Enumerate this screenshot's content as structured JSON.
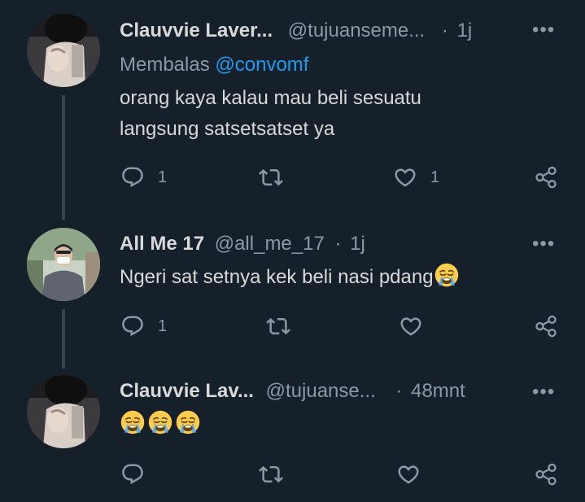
{
  "tweets": [
    {
      "name": "Clauvvie Laver...",
      "handle": "@tujuanseme...",
      "dot": "·",
      "time": "1j",
      "more": "•••",
      "reply_prefix": "Membalas",
      "reply_mention": "@convomf",
      "lines": [
        "orang kaya kalau mau beli sesuatu",
        "langsung satsetsatset ya"
      ],
      "reply_count": "1",
      "retweet_count": "",
      "like_count": "1"
    },
    {
      "name": "All Me 17",
      "handle": "@all_me_17",
      "dot": "·",
      "time": "1j",
      "more": "•••",
      "text": "Ngeri sat setnya kek beli nasi pdang",
      "reply_count": "1",
      "retweet_count": "",
      "like_count": ""
    },
    {
      "name": "Clauvvie Lav...",
      "handle": "@tujuanse...",
      "dot": "·",
      "time": "48mnt",
      "more": "•••",
      "emoji_count": 3,
      "reply_count": "",
      "retweet_count": "",
      "like_count": ""
    }
  ],
  "icons": {
    "reply": "reply-icon",
    "retweet": "retweet-icon",
    "like": "heart-icon",
    "share": "share-icon",
    "emoji": "loudly-crying-face-emoji"
  },
  "colors": {
    "background": "#15202b",
    "text": "#d9d9d9",
    "muted": "#8b98a5",
    "link": "#1d9bf0",
    "thread_line": "#38444d"
  }
}
